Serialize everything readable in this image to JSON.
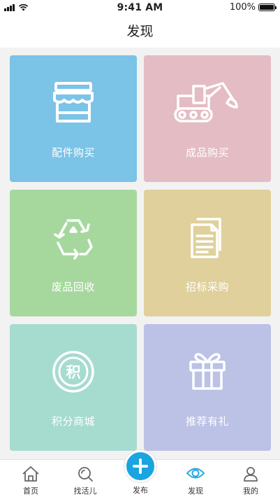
{
  "status_bar": {
    "time": "9:41 AM",
    "battery": "100%"
  },
  "header": {
    "title": "发现"
  },
  "tiles": [
    {
      "label": "配件购买",
      "icon": "storefront-icon",
      "color": "#7bc3e7"
    },
    {
      "label": "成品购买",
      "icon": "excavator-icon",
      "color": "#e4bcc4"
    },
    {
      "label": "废品回收",
      "icon": "recycle-icon",
      "color": "#a6d89e"
    },
    {
      "label": "招标采购",
      "icon": "documents-icon",
      "color": "#dfd09c"
    },
    {
      "label": "积分商城",
      "icon": "points-coin-icon",
      "color": "#a6dbd0"
    },
    {
      "label": "推荐有礼",
      "icon": "gift-icon",
      "color": "#bcc1e6"
    }
  ],
  "tabbar": {
    "items": [
      {
        "label": "首页",
        "icon": "home-icon"
      },
      {
        "label": "找活儿",
        "icon": "search-icon"
      },
      {
        "label": "发布",
        "icon": "plus-icon"
      },
      {
        "label": "发现",
        "icon": "eye-icon",
        "active": true
      },
      {
        "label": "我的",
        "icon": "user-icon"
      }
    ],
    "active_color": "#25a8e0"
  }
}
